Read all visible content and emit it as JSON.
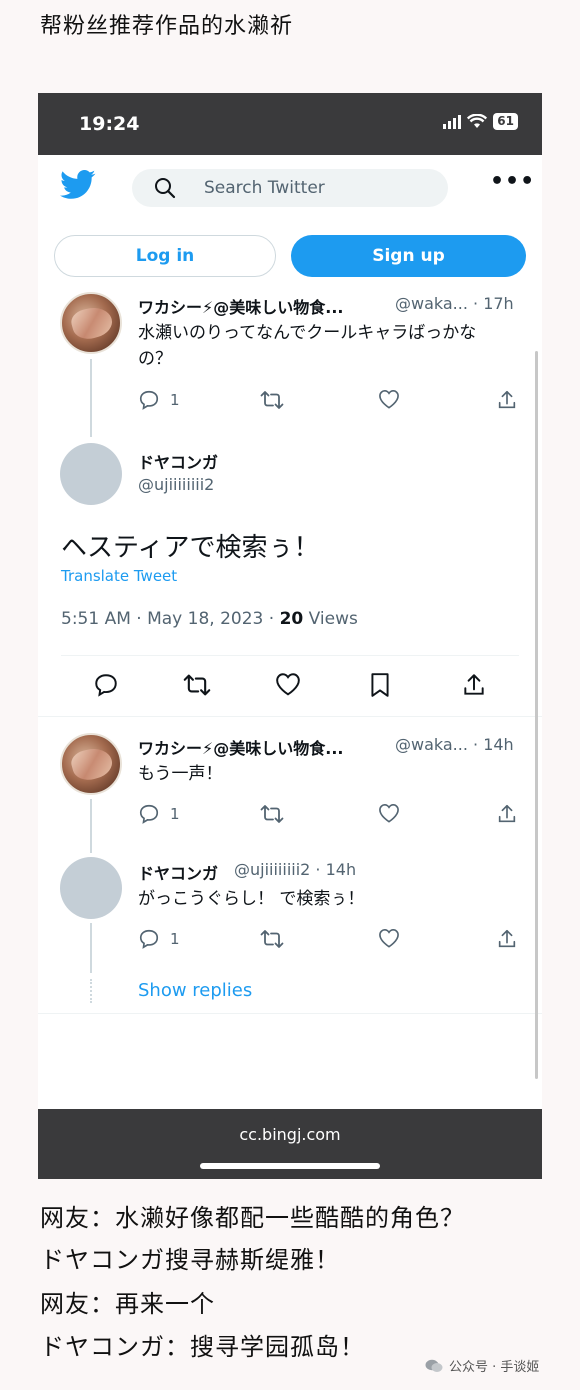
{
  "header_caption": "帮粉丝推荐作品的水濑祈",
  "status_bar": {
    "time": "19:24",
    "battery": "61"
  },
  "twitter": {
    "search_placeholder": "Search Twitter",
    "more_label": "•••",
    "login_label": "Log in",
    "signup_label": "Sign up",
    "tweets": [
      {
        "name": "ワカシー⚡@美味しい物食...",
        "handle": "@waka... · 17h",
        "text": "水瀬いのりってなんでクールキャラばっかなの？",
        "replies": "1"
      },
      {
        "name": "ドヤコンガ",
        "handle": "@ujiiiiiiii2"
      },
      {
        "name": "ワカシー⚡@美味しい物食...",
        "handle": "@waka... · 14h",
        "text": "もう一声！",
        "replies": "1"
      },
      {
        "name": "ドヤコンガ",
        "handle": "@ujiiiiiiii2 · 14h",
        "text": "がっこうぐらし！ で検索ぅ！",
        "replies": "1"
      }
    ],
    "main_tweet": {
      "text": "ヘスティアで検索ぅ！",
      "translate": "Translate Tweet",
      "time": "5:51 AM · May 18, 2023 · ",
      "views_count": "20",
      "views_label": " Views"
    },
    "show_replies": "Show replies"
  },
  "browser_url": "cc.bingj.com",
  "captions": [
    "网友：水濑好像都配一些酷酷的角色？",
    "ドヤコンガ搜寻赫斯缇雅！",
    "网友：再来一个",
    "ドヤコンガ：搜寻学园孤岛！"
  ],
  "watermark": "公众号 · 手谈姬",
  "colors": {
    "twitter_blue": "#1d9bf0",
    "dark_bar": "#3a3a3c"
  }
}
